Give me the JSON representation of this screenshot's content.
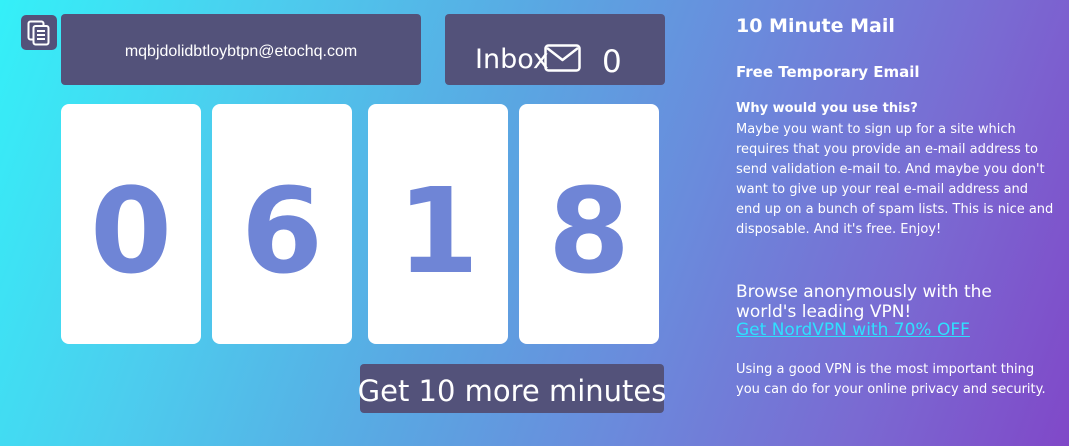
{
  "copy_button": {
    "icon": "copy-document-icon"
  },
  "email": {
    "address": "mqbjdolidbtloybtpn@etochq.com"
  },
  "inbox": {
    "label": "Inbox",
    "icon": "envelope-icon",
    "count": "0"
  },
  "timer": {
    "digits": [
      "0",
      "6",
      "1",
      "8"
    ]
  },
  "more_time_button": {
    "label": "Get 10 more minutes"
  },
  "sidebar": {
    "title": "10 Minute Mail",
    "subtitle": "Free Temporary Email",
    "why_heading": "Why would you use this?",
    "why_body": "Maybe you want to sign up for a site which requires that you provide an e-mail address to send validation e-mail to. And maybe you don't want to give up your real e-mail address and end up on a bunch of spam lists. This is nice and disposable. And it's free. Enjoy!",
    "vpn_heading": "Browse anonymously with the world's leading VPN!",
    "vpn_link": "Get NordVPN with 70% OFF",
    "vpn_body": "Using a good VPN is the most important thing you can do for your online privacy and security."
  },
  "colors": {
    "panel": "#53527a",
    "digit": "#6f85d6",
    "link": "#2fe0ff"
  }
}
